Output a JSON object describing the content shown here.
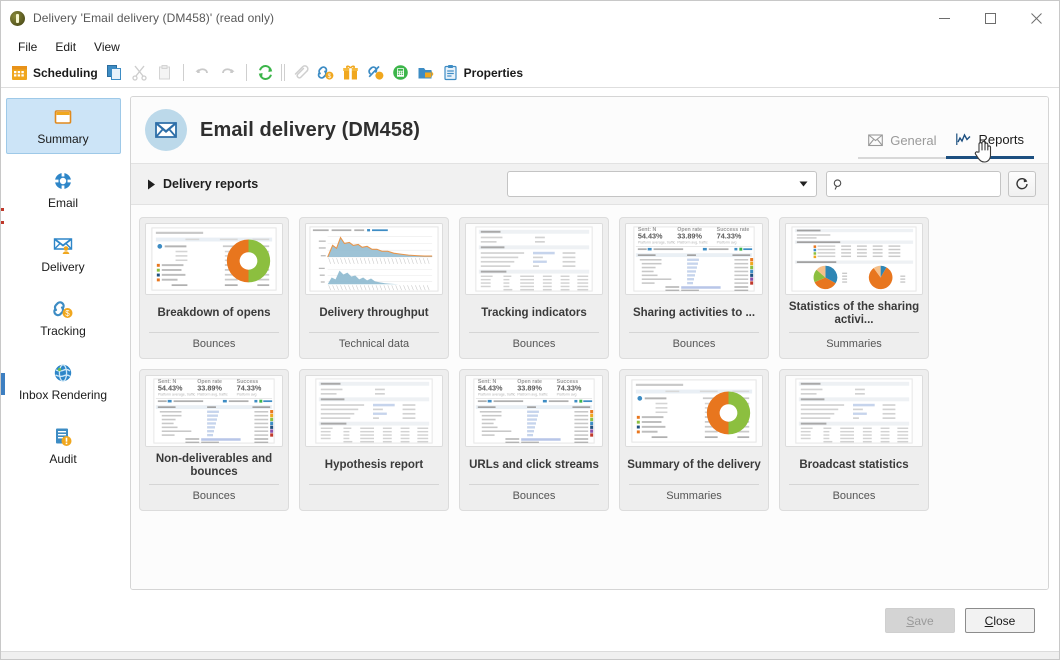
{
  "window": {
    "title": "Delivery 'Email delivery (DM458)' (read only)",
    "app_icon": "adobe-campaign-icon",
    "minimize": "minimize-icon",
    "maximize": "maximize-icon",
    "close": "close-icon"
  },
  "menubar": {
    "items": [
      {
        "label": "File"
      },
      {
        "label": "Edit"
      },
      {
        "label": "View"
      }
    ]
  },
  "toolbar": {
    "scheduling_label": "Scheduling",
    "properties_label": "Properties",
    "icons": [
      {
        "name": "calendar-icon",
        "enabled": true
      },
      {
        "name": "copy-icon",
        "enabled": true
      },
      {
        "name": "cut-icon",
        "enabled": false
      },
      {
        "name": "paste-icon",
        "enabled": false
      },
      {
        "name": "undo-icon",
        "enabled": false
      },
      {
        "name": "redo-icon",
        "enabled": false
      },
      {
        "name": "refresh-icon",
        "enabled": true
      },
      {
        "name": "attachment-icon",
        "enabled": false
      },
      {
        "name": "tracking-link-icon",
        "enabled": true
      },
      {
        "name": "gift-icon",
        "enabled": true
      },
      {
        "name": "no-tracking-icon",
        "enabled": true
      },
      {
        "name": "calculator-icon",
        "enabled": true
      },
      {
        "name": "export-icon",
        "enabled": true
      },
      {
        "name": "clipboard-icon",
        "enabled": true
      }
    ]
  },
  "sidebar": {
    "items": [
      {
        "label": "Summary",
        "icon": "window-icon",
        "selected": true
      },
      {
        "label": "Email",
        "icon": "target-icon",
        "selected": false
      },
      {
        "label": "Delivery",
        "icon": "envelope-person-icon",
        "selected": false
      },
      {
        "label": "Tracking",
        "icon": "link-icon",
        "selected": false
      },
      {
        "label": "Inbox Rendering",
        "icon": "globe-icon",
        "selected": false
      },
      {
        "label": "Audit",
        "icon": "audit-icon",
        "selected": false
      }
    ]
  },
  "header": {
    "title": "Email delivery (DM458)",
    "avatar_icon": "envelope-icon",
    "tabs": [
      {
        "label": "General",
        "icon": "envelope-icon",
        "active": false
      },
      {
        "label": "Reports",
        "icon": "chart-line-icon",
        "active": true
      }
    ]
  },
  "filter_bar": {
    "expand_icon": "triangle-right-icon",
    "label": "Delivery reports",
    "select_value": "",
    "select_icon": "chevron-down-icon",
    "search_icon": "search-icon",
    "search_value": "",
    "search_placeholder": "",
    "refresh_icon": "refresh-icon"
  },
  "reports": [
    {
      "title": "Breakdown of opens",
      "category": "Bounces",
      "thumb": "donut-table"
    },
    {
      "title": "Delivery throughput",
      "category": "Technical data",
      "thumb": "area-charts"
    },
    {
      "title": "Tracking indicators",
      "category": "Bounces",
      "thumb": "data-table"
    },
    {
      "title": "Sharing activities to ...",
      "category": "Bounces",
      "thumb": "stats-table"
    },
    {
      "title": "Statistics of the sharing activi...",
      "category": "Summaries",
      "thumb": "pie-pair"
    },
    {
      "title": "Non-deliverables and bounces",
      "category": "Bounces",
      "thumb": "stats-table"
    },
    {
      "title": "Hypothesis report",
      "category": "",
      "thumb": "data-table"
    },
    {
      "title": "URLs and click streams",
      "category": "Bounces",
      "thumb": "stats-table"
    },
    {
      "title": "Summary of the delivery",
      "category": "Summaries",
      "thumb": "donut-table"
    },
    {
      "title": "Broadcast statistics",
      "category": "Bounces",
      "thumb": "data-table"
    }
  ],
  "footer": {
    "save_label": "Save",
    "save_accel": "S",
    "close_label": "Close",
    "close_accel": "C",
    "save_enabled": false
  },
  "colors": {
    "accent": "#1c4f80",
    "selection": "#cce4f7",
    "orange": "#e8761e",
    "green": "#8cbf3f",
    "blue": "#2e86b5",
    "panel_bg": "#fcfcfc",
    "card_bg": "#eeeeee"
  }
}
